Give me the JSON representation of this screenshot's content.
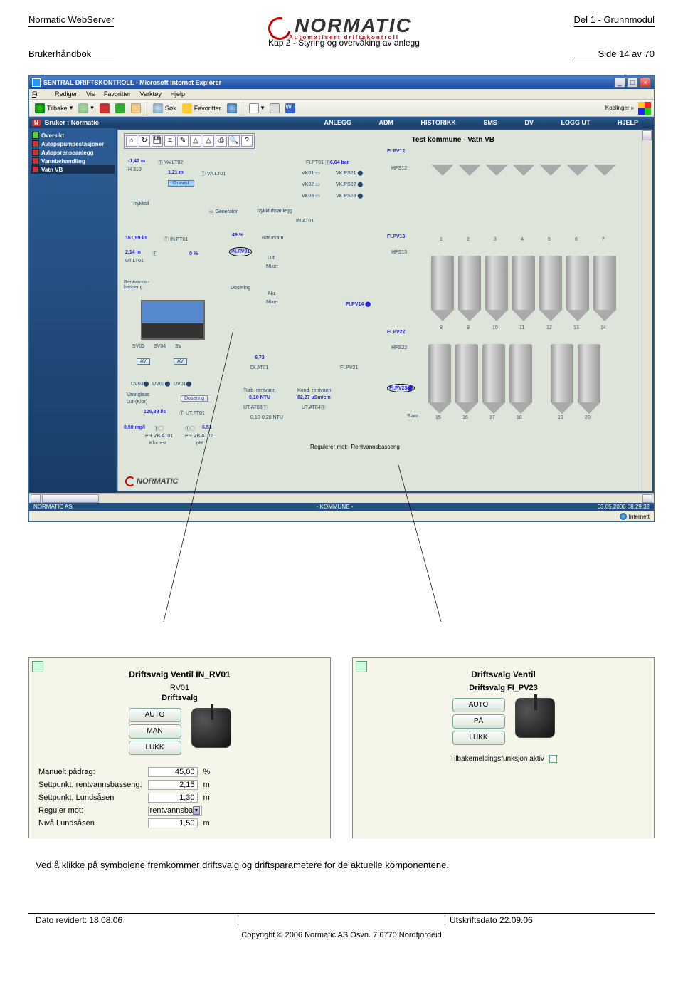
{
  "header": {
    "left_title": "Normatic WebServer",
    "left_sub": "Brukerhåndbok",
    "right_title": "Del 1 - Grunnmodul",
    "right_sub": "Side 14 av 70",
    "logo_text": "NORMATIC",
    "logo_sub": "Automatisert driftskontroll",
    "chapter": "Kap 2 - Styring og overvåking av anlegg"
  },
  "browser": {
    "title": "SENTRAL DRIFTSKONTROLL - Microsoft Internet Explorer",
    "menu": {
      "fil": "Fil",
      "rediger": "Rediger",
      "vis": "Vis",
      "fav": "Favoritter",
      "verk": "Verktøy",
      "hjelp": "Hjelp"
    },
    "tool": {
      "back": "Tilbake",
      "search": "Søk",
      "favorites": "Favoritter",
      "links": "Koblinger"
    },
    "appnav": {
      "brand": "N",
      "user": "Bruker : Normatic",
      "tabs": [
        "ANLEGG",
        "ADM",
        "HISTORIKK",
        "SMS",
        "DV",
        "LOGG UT",
        "HJELP"
      ]
    },
    "sidebar": [
      {
        "cls": "",
        "label": "Oversikt"
      },
      {
        "cls": "red",
        "label": "Avløpspumpestasjoner"
      },
      {
        "cls": "red",
        "label": "Avløpsrenseanlegg"
      },
      {
        "cls": "red",
        "label": "Vannbehandling"
      },
      {
        "cls": "red sel",
        "label": "Vatn VB"
      }
    ],
    "canvas": {
      "title": "Test kommune - Vatn VB",
      "labels": {
        "valt02": "VA.LT02",
        "valt01": "VA.LT01",
        "val1": "-1,42 m",
        "h310": "H 310",
        "val2": "1,21 m",
        "grovist": "Grøvist",
        "trykksil": "Trykksil",
        "generator": "Generator",
        "trykkluft": "Trykkluftsanlegg",
        "inat01": "IN.AT01",
        "fipt01": "FI.PT01",
        "bar": "6,64 bar",
        "vk01": "VK01",
        "vk02": "VK02",
        "vk03": "VK03",
        "vkps01": "VK.PS01",
        "vkps02": "VK.PS02",
        "vkps03": "VK.PS03",
        "fipv12": "FI.PV12",
        "hps12": "HPS12",
        "flow": "161,99 l/s",
        "inft01": "IN.FT01",
        "pct": "49 %",
        "raturvatn": "Raturvatn",
        "utlt01": "UT.LT01",
        "lev": "2,14 m",
        "zero": "0 %",
        "inrv01": "IN.RV01",
        "fipv13": "FI.PV13",
        "hps13": "HPS13",
        "rent": "Rentvanns-\nbasseng",
        "lut": "Lut",
        "mixer": "Mixer",
        "dosering": "Dosering",
        "alu": "Alu.",
        "mixer2": "Mixer",
        "fipv14": "FI.PV14",
        "sv05": "SV05",
        "sv04": "SV04",
        "sv": "SV",
        "av": "AV",
        "uv01": "UV01",
        "uv02": "UV02",
        "uv03": "UV03",
        "vannglass": "Vannglass",
        "lutkl": "Lut-(Klor)",
        "dosering2": "Dosering",
        "fipv22": "FI.PV22",
        "hps22": "HPS22",
        "diat01": "DI.AT01",
        "val673": "6,73",
        "fipv21": "FI.PV21",
        "turb": "Turb. rentvann",
        "turb_v": "0,10 NTU",
        "utat03": "UT.AT03",
        "kond": "Kond. rentvann",
        "kond_v": "82,27 uSm/cm",
        "utat04": "UT.AT04",
        "range": "0,10-0,20 NTU",
        "flow2": "125,83 l/s",
        "utft01": "UT.FT01",
        "phv1": "0,00 mg/l",
        "phlbl1": "PH.VB.AT01",
        "klorrest": "Klorrest",
        "phv2": "6,51",
        "phlbl2": "PH.VB.AT02",
        "ph": "pH",
        "fipv23": "FI.PV23",
        "slam": "Slam",
        "reg": "Regulerer mot:",
        "regv": "Rentvannsbasseng",
        "nlogo": "NORMATIC"
      },
      "tank_nums_top": [
        "1",
        "2",
        "3",
        "4",
        "5",
        "6",
        "7"
      ],
      "tank_nums_bot": [
        "8",
        "9",
        "10",
        "11",
        "12",
        "13",
        "14",
        "15",
        "16",
        "17",
        "18",
        "19",
        "20"
      ]
    },
    "footer": {
      "left": "NORMATIC AS",
      "mid": "- KOMMUNE -",
      "right": "03.05.2006 08:29:32"
    },
    "status": {
      "internett": "Internett"
    }
  },
  "dialogs": {
    "left": {
      "title": "Driftsvalg Ventil IN_RV01",
      "sub1": "RV01",
      "sub2": "Driftsvalg",
      "opts": [
        "AUTO",
        "MAN",
        "LUKK"
      ],
      "params": [
        {
          "label": "Manuelt pådrag:",
          "value": "45,00",
          "unit": "%"
        },
        {
          "label": "Settpunkt, rentvannsbasseng:",
          "value": "2,15",
          "unit": "m"
        },
        {
          "label": "Settpunkt, Lundsåsen",
          "value": "1,30",
          "unit": "m"
        },
        {
          "label": "Reguler mot:",
          "select": "rentvannsba"
        },
        {
          "label": "Nivå Lundsåsen",
          "value": "1,50",
          "unit": "m"
        }
      ]
    },
    "right": {
      "title": "Driftsvalg Ventil",
      "sub2": "Driftsvalg FI_PV23",
      "opts": [
        "AUTO",
        "PÅ",
        "LUKK"
      ],
      "checkbox": "Tilbakemeldingsfunksjon aktiv"
    }
  },
  "body_text": "Ved å klikke på symbolene fremkommer driftsvalg og driftsparametere for de aktuelle komponentene.",
  "footer": {
    "left": "Dato revidert: 18.08.06",
    "right": "Utskriftsdato 22.09.06",
    "copyright": "Copyright © 2006  Normatic AS Osvn. 7 6770 Nordfjordeid"
  }
}
